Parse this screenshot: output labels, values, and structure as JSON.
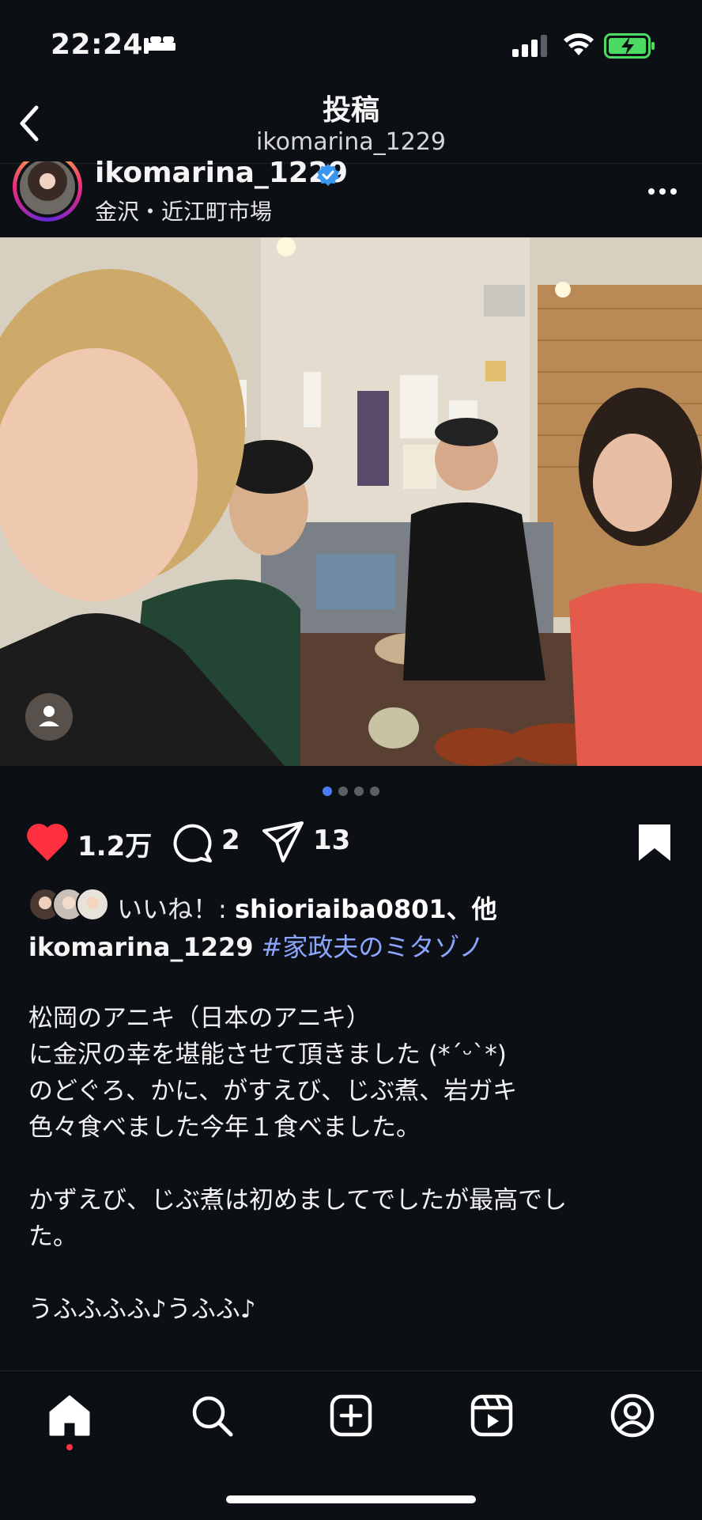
{
  "status_bar": {
    "time": "22:24"
  },
  "header": {
    "title": "投稿",
    "subtitle": "ikomarina_1229"
  },
  "post": {
    "username": "ikomarina_1229",
    "location": "金沢・近江町市場",
    "carousel_total": 4,
    "carousel_active": 1
  },
  "actions": {
    "likes": "1.2万",
    "comments": "2",
    "shares": "13"
  },
  "likes_line": {
    "label": "いいね！: ",
    "user": "shioriaiba0801",
    "suffix": "、他"
  },
  "caption": {
    "username": "ikomarina_1229",
    "hashtag": "#家政夫のミタゾノ",
    "lines": [
      "松岡のアニキ（日本のアニキ）",
      "に金沢の幸を堪能させて頂きました (*´ᵕ`*)",
      "のどぐろ、かに、がすえび、じぶ煮、岩ガキ",
      "色々食べました今年１食べました。",
      "",
      "かずえび、じぶ煮は初めましてでしたが最高でし",
      "た。",
      "",
      "うふふふふ♪うふふ♪"
    ]
  },
  "nav": [
    "home-icon",
    "search-icon",
    "create-icon",
    "reels-icon",
    "profile-icon"
  ],
  "colors": {
    "background": "#0c0f14",
    "like": "#ff3040",
    "hashtag": "#8ba6ff",
    "verified": "#3897f0",
    "active_dot": "#4a7cf6"
  }
}
